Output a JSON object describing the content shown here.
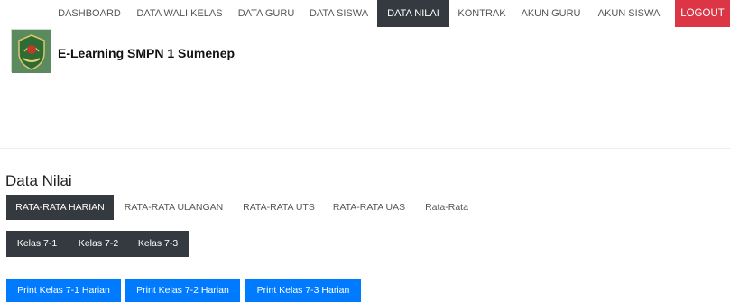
{
  "nav": {
    "items": [
      "DASHBOARD",
      "DATA WALI KELAS",
      "DATA GURU",
      "DATA SISWA",
      "DATA NILAI",
      "KONTRAK",
      "AKUN GURU",
      "AKUN SISWA"
    ],
    "active": "DATA NILAI",
    "logout_label": "LOGOUT"
  },
  "brand": {
    "title": "E-Learning SMPN 1 Sumenep"
  },
  "main": {
    "title": "Data Nilai",
    "tabs": [
      "RATA-RATA HARIAN",
      "RATA-RATA ULANGAN",
      "RATA-RATA UTS",
      "RATA-RATA UAS",
      "Rata-Rata"
    ],
    "active_tab": "RATA-RATA HARIAN",
    "kelas": [
      "Kelas 7-1",
      "Kelas 7-2",
      "Kelas 7-3"
    ],
    "print_buttons": [
      "Print Kelas 7-1 Harian",
      "Print Kelas 7-2 Harian",
      "Print Kelas 7-3 Harian"
    ]
  },
  "colors": {
    "nav_active_bg": "#343a40",
    "logout_bg": "#dc3545",
    "primary_button": "#007bff"
  },
  "icons": {
    "logo": "school-emblem-icon"
  }
}
